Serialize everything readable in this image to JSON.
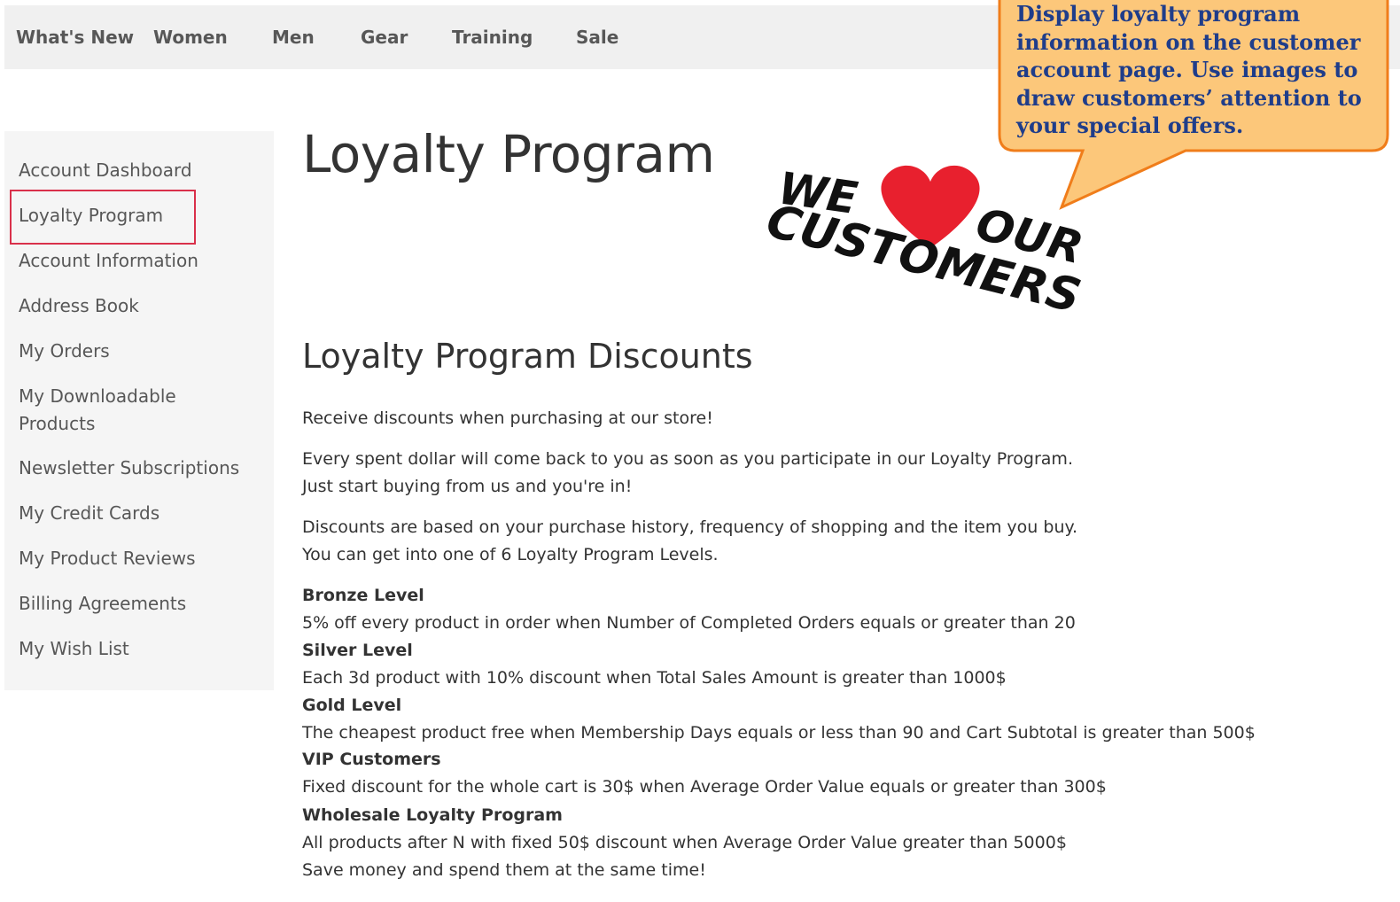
{
  "topnav": {
    "items": [
      "What's New",
      "Women",
      "Men",
      "Gear",
      "Training",
      "Sale"
    ]
  },
  "sidebar": {
    "items": [
      {
        "label": "Account Dashboard"
      },
      {
        "label": "Loyalty Program"
      },
      {
        "label": "Account Information"
      },
      {
        "label": "Address Book"
      },
      {
        "label": "My Orders"
      },
      {
        "label": "My Downloadable Products"
      },
      {
        "label": "Newsletter Subscriptions"
      },
      {
        "label": "My Credit Cards"
      },
      {
        "label": "My Product Reviews"
      },
      {
        "label": "Billing Agreements"
      },
      {
        "label": "My Wish List"
      }
    ],
    "active": "Loyalty Program"
  },
  "main": {
    "title": "Loyalty Program",
    "section_title": "Loyalty Program Discounts",
    "intro": "Receive discounts when purchasing at our store!",
    "para1_line1": "Every spent dollar will come back to you as soon as you participate in our Loyalty Program.",
    "para1_line2": "Just start buying from us and you're in!",
    "para2_line1": "Discounts are based on your purchase history, frequency of shopping and the item you buy.",
    "para2_line2": "You can get into one of 6 Loyalty Program Levels.",
    "levels": [
      {
        "name": "Bronze Level",
        "desc": "5% off every product in order when Number of Completed Orders equals or greater than 20"
      },
      {
        "name": "Silver Level",
        "desc": "Each 3d product with 10% discount when Total Sales Amount is greater than 1000$"
      },
      {
        "name": "Gold Level",
        "desc": "The cheapest product free when Membership Days equals or less than 90 and Cart Subtotal is greater than 500$"
      },
      {
        "name": "VIP Customers",
        "desc": "Fixed discount for the whole cart is 30$ when Average Order Value equals or greater than 300$"
      },
      {
        "name": "Wholesale Loyalty Program",
        "desc": "All products after N with fixed 50$ discount when Average Order Value greater than 5000$"
      }
    ],
    "closing": "Save money and spend them at the same time!"
  },
  "graphic": {
    "line1": "WE",
    "line1b": "OUR",
    "line2": "CUSTOMERS",
    "heart_color": "#e8202e"
  },
  "callout": {
    "text": "Display loyalty program information on the customer account page. Use images to draw customers’ attention to your special offers.",
    "fill": "#fcc77a",
    "border": "#f07d1a",
    "text_color": "#1f3d8a"
  }
}
